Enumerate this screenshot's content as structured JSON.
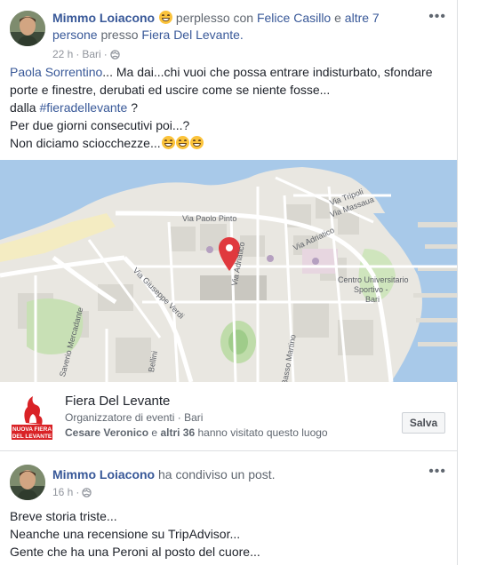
{
  "post1": {
    "author": "Mimmo Loiacono",
    "feeling": "perplesso con",
    "tag1": "Felice Casillo",
    "and_text": "e",
    "others": "altre 7 persone",
    "at_text": "presso",
    "location": "Fiera Del Levante.",
    "time": "22 h",
    "place": "Bari",
    "more": "•••",
    "lines": {
      "l1_mention": "Paola Sorrentino",
      "l1_rest": "... Ma dai...chi vuoi che possa entrare indisturbato, sfondare",
      "l2": "porte e finestre, derubati ed uscire come se niente fosse...",
      "l3_pre": "dalla",
      "l3_hashtag": "#fieradellevante",
      "l3_post": "?",
      "l4": "Per due giorni consecutivi poi...?",
      "l5": "Non diciamo sciocchezze..."
    },
    "map_labels": {
      "paolo_pinto": "Via Paolo Pinto",
      "tripoli": "Via Tripoli",
      "massaua": "Via Massaua",
      "adriatico": "Via Adriatico",
      "adriatico2": "Via Adriatico",
      "verdi": "Via Giuseppe Verdi",
      "mercadante": "Saverio Mercadante",
      "bellini": "Bellini",
      "martino": "Basso Martino",
      "cus1": "Centro Universitario",
      "cus2": "Sportivo -",
      "cus3": "Bari"
    },
    "place_card": {
      "logo_text1": "NUOVA FIERA",
      "logo_text2": "DEL LEVANTE",
      "title": "Fiera Del Levante",
      "subtitle": "Organizzatore di eventi · Bari",
      "visitor1": "Cesare Veronico",
      "visitor_and": "e",
      "visitor_others": "altri 36",
      "visitor_tail": "hanno visitato questo luogo",
      "save_label": "Salva"
    }
  },
  "post2": {
    "author": "Mimmo Loiacono",
    "action": "ha condiviso un post.",
    "time": "16 h",
    "more": "•••",
    "lines": [
      "Breve storia triste...",
      "Neanche una recensione su TripAdvisor...",
      "Gente che ha una Peroni al posto del cuore..."
    ]
  },
  "colors": {
    "link": "#385898",
    "pin": "#e0393e",
    "sea": "#a8c9e9",
    "logo_red": "#d92226"
  }
}
